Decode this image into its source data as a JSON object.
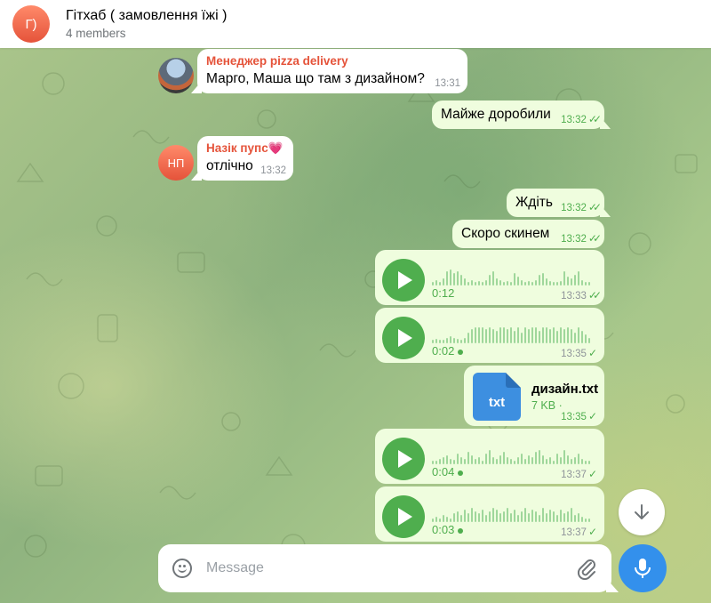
{
  "header": {
    "avatar_initial": "Г)",
    "title": "Гітхаб ( замовлення їжі )",
    "subtitle": "4 members"
  },
  "messages": [
    {
      "type": "incoming",
      "sender": "Менеджер pizza delivery",
      "text": "Марго, Маша що там з дизайном?",
      "time": "13:31"
    },
    {
      "type": "outgoing",
      "text": "Майже доробили",
      "time": "13:32",
      "status": "read"
    },
    {
      "type": "incoming",
      "sender": "Назік пупс💗",
      "avatar_initials": "НП",
      "text": "отлічно",
      "time": "13:32"
    },
    {
      "type": "outgoing",
      "text": "Ждіть",
      "time": "13:32",
      "status": "read"
    },
    {
      "type": "outgoing",
      "text": "Скоро скинем",
      "time": "13:32",
      "status": "read"
    },
    {
      "type": "voice",
      "duration": "0:12",
      "time": "13:33",
      "status": "read"
    },
    {
      "type": "voice",
      "duration": "0:02",
      "time": "13:35",
      "status": "sent",
      "unplayed": true
    },
    {
      "type": "file",
      "icon_label": "txt",
      "file_name": "дизайн.txt",
      "file_size": "7 KB ·",
      "time": "13:35",
      "status": "sent"
    },
    {
      "type": "voice",
      "duration": "0:04",
      "time": "13:37",
      "status": "sent",
      "unplayed": true
    },
    {
      "type": "voice",
      "duration": "0:03",
      "time": "13:37",
      "status": "sent",
      "unplayed": true
    }
  ],
  "composer": {
    "placeholder": "Message",
    "value": ""
  },
  "icons": {
    "scroll": "arrow-down-icon",
    "mic": "microphone-icon",
    "emoji": "smile-icon",
    "attach": "paperclip-icon"
  },
  "colors": {
    "accent": "#3390ec",
    "outgoing_bubble": "#effdde",
    "check": "#4fae4e",
    "sender_name": "#e5533a"
  }
}
